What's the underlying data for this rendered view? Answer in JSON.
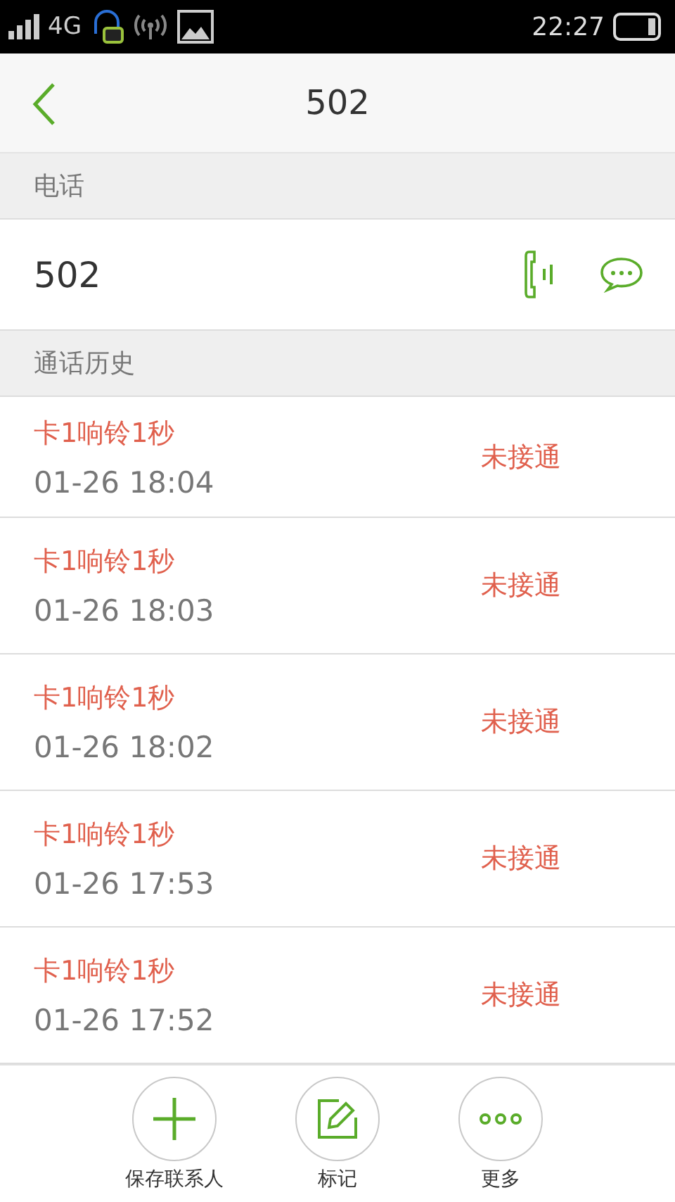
{
  "status_bar": {
    "network": "4G",
    "time": "22:27"
  },
  "header": {
    "title": "502"
  },
  "phone_section": {
    "label": "电话",
    "number": "502"
  },
  "history_section": {
    "label": "通话历史"
  },
  "calls": [
    {
      "description": "卡1响铃1秒",
      "time": "01-26 18:04",
      "status": "未接通"
    },
    {
      "description": "卡1响铃1秒",
      "time": "01-26 18:03",
      "status": "未接通"
    },
    {
      "description": "卡1响铃1秒",
      "time": "01-26 18:02",
      "status": "未接通"
    },
    {
      "description": "卡1响铃1秒",
      "time": "01-26 17:53",
      "status": "未接通"
    },
    {
      "description": "卡1响铃1秒",
      "time": "01-26 17:52",
      "status": "未接通"
    }
  ],
  "actions": [
    {
      "kind": "add",
      "label": "保存联系人"
    },
    {
      "kind": "edit",
      "label": "标记"
    },
    {
      "kind": "more",
      "label": "更多"
    }
  ]
}
